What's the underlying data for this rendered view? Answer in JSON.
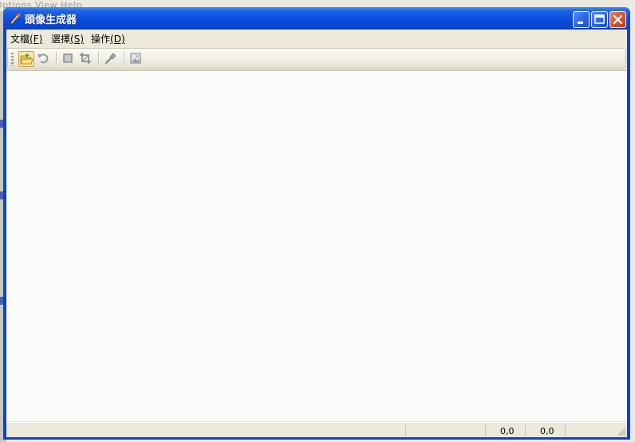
{
  "background_app": {
    "menu_text": "Options   View   Help"
  },
  "window": {
    "title": "頭像生成器",
    "icon": "feather-pen-icon",
    "controls": [
      "minimize-icon",
      "maximize-icon",
      "close-icon"
    ]
  },
  "menu": {
    "items": [
      {
        "label": "文檔",
        "mnemonic": "(F)"
      },
      {
        "label": "選擇",
        "mnemonic": "(S)"
      },
      {
        "label": "操作",
        "mnemonic": "(D)"
      }
    ]
  },
  "toolbar": {
    "buttons": [
      "open-folder-icon",
      "undo-icon",
      "square-select-icon",
      "crop-icon",
      "brush-icon",
      "image-icon"
    ]
  },
  "status": {
    "coord1": "0,0",
    "coord2": "0,0"
  }
}
